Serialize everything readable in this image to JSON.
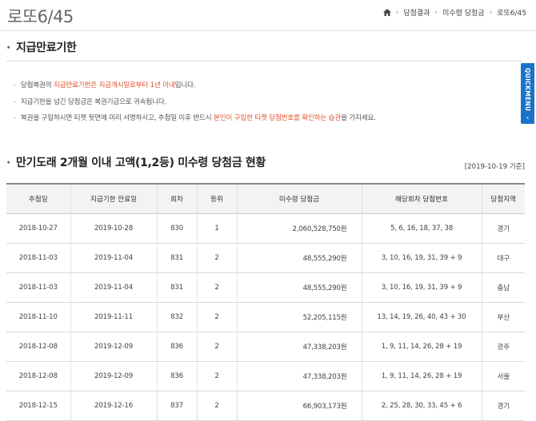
{
  "header": {
    "title": "로또6/45",
    "breadcrumb": [
      "당첨결과",
      "미수령 당첨금",
      "로또6/45"
    ]
  },
  "section1": {
    "title": "지급만료기한",
    "notes": [
      {
        "parts": [
          {
            "text": "당첨복권의 ",
            "red": false
          },
          {
            "text": "지급만료기한은 지급개시일로부터 1년 이내",
            "red": true
          },
          {
            "text": "입니다.",
            "red": false
          }
        ]
      },
      {
        "parts": [
          {
            "text": "지급기한을 넘긴 당첨금은 복권기금으로 귀속됩니다.",
            "red": false
          }
        ]
      },
      {
        "parts": [
          {
            "text": "복권을 구입하시면 티켓 뒷면에 미리 서명하시고, 추첨일 이후 반드시 ",
            "red": false
          },
          {
            "text": "본인이 구입한 티켓 당첨번호를 확인하는 습관",
            "red": true
          },
          {
            "text": "을 가지세요.",
            "red": false
          }
        ]
      }
    ]
  },
  "section2": {
    "title": "만기도래 2개월 이내 고액(1,2등) 미수령 당첨금 현황",
    "as_of": "[2019-10-19 기준]"
  },
  "quickmenu": {
    "label": "QUICKMENU",
    "arrow": "‹"
  },
  "table": {
    "headers": [
      "추첨일",
      "지급기한 만료일",
      "회차",
      "등위",
      "미수령 당첨금",
      "해당회차 당첨번호",
      "당첨지역"
    ],
    "rows": [
      [
        "2018-10-27",
        "2019-10-28",
        "830",
        "1",
        "2,060,528,750원",
        "5, 6, 16, 18, 37, 38",
        "경기"
      ],
      [
        "2018-11-03",
        "2019-11-04",
        "831",
        "2",
        "48,555,290원",
        "3, 10, 16, 19, 31, 39 + 9",
        "대구"
      ],
      [
        "2018-11-03",
        "2019-11-04",
        "831",
        "2",
        "48,555,290원",
        "3, 10, 16, 19, 31, 39 + 9",
        "충남"
      ],
      [
        "2018-11-10",
        "2019-11-11",
        "832",
        "2",
        "52,205,115원",
        "13, 14, 19, 26, 40, 43 + 30",
        "부산"
      ],
      [
        "2018-12-08",
        "2019-12-09",
        "836",
        "2",
        "47,338,203원",
        "1, 9, 11, 14, 26, 28 + 19",
        "광주"
      ],
      [
        "2018-12-08",
        "2019-12-09",
        "836",
        "2",
        "47,338,203원",
        "1, 9, 11, 14, 26, 28 + 19",
        "서울"
      ],
      [
        "2018-12-15",
        "2019-12-16",
        "837",
        "2",
        "66,903,173원",
        "2, 25, 28, 30, 33, 45 + 6",
        "경기"
      ]
    ]
  },
  "colors": {
    "accent_red": "#e0522c",
    "quickmenu_blue": "#1a73c9"
  }
}
